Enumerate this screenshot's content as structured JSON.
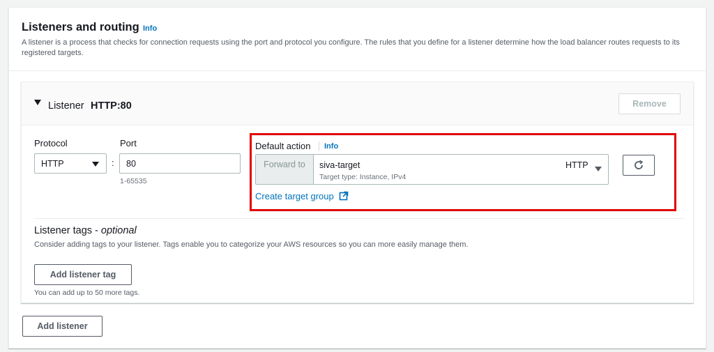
{
  "section": {
    "title": "Listeners and routing",
    "info": "Info",
    "description": "A listener is a process that checks for connection requests using the port and protocol you configure. The rules that you define for a listener determine how the load balancer routes requests to its registered targets."
  },
  "listener": {
    "label": "Listener",
    "value": "HTTP:80",
    "remove_label": "Remove",
    "protocol": {
      "label": "Protocol",
      "selected": "HTTP"
    },
    "port": {
      "label": "Port",
      "value": "80",
      "hint": "1-65535"
    },
    "default_action": {
      "label": "Default action",
      "info": "Info",
      "forward_label": "Forward to",
      "target_name": "siva-target",
      "target_type": "Target type: Instance, IPv4",
      "target_protocol": "HTTP",
      "create_link": "Create target group",
      "highlight_color": "#e00000"
    },
    "tags": {
      "title": "Listener tags - ",
      "title_optional": "optional",
      "description": "Consider adding tags to your listener. Tags enable you to categorize your AWS resources so you can more easily manage them.",
      "add_label": "Add listener tag",
      "hint": "You can add up to 50 more tags."
    }
  },
  "add_listener_label": "Add listener",
  "icons": {
    "caret": "caret-down-icon",
    "external": "external-link-icon",
    "refresh": "refresh-icon",
    "dropdown": "chevron-down-icon"
  },
  "colors": {
    "link": "#0073bb",
    "text": "#16191f",
    "muted": "#545b64"
  }
}
